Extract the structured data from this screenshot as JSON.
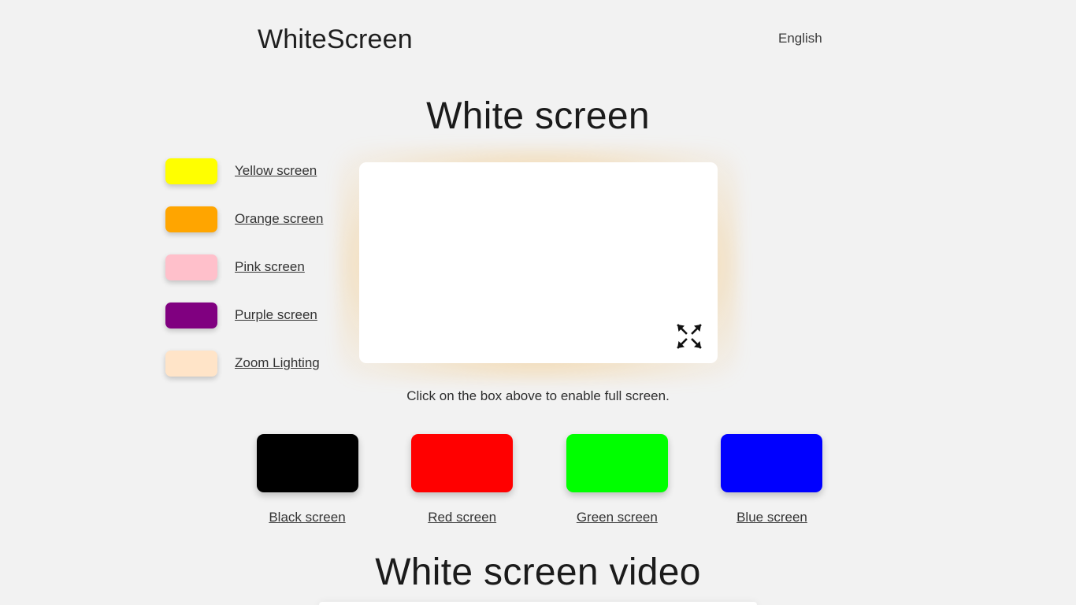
{
  "header": {
    "brand": "WhiteScreen",
    "language": "English"
  },
  "page": {
    "title": "White screen",
    "caption": "Click on the box above to enable full screen.",
    "section_title": "White screen video"
  },
  "sidebar": {
    "items": [
      {
        "label": "Yellow screen",
        "color": "#FFFF00"
      },
      {
        "label": "Orange screen",
        "color": "#FFA500"
      },
      {
        "label": "Pink screen",
        "color": "#FFC0CB"
      },
      {
        "label": "Purple screen",
        "color": "#800080"
      },
      {
        "label": "Zoom Lighting",
        "color": "#FFE4C8"
      }
    ]
  },
  "tiles": [
    {
      "label": "Black screen",
      "color": "#000000"
    },
    {
      "label": "Red screen",
      "color": "#FF0000"
    },
    {
      "label": "Green screen",
      "color": "#00FF00"
    },
    {
      "label": "Blue screen",
      "color": "#0000FF"
    }
  ],
  "screen": {
    "color": "#FFFFFF",
    "glow_color": "#F6B246",
    "fullscreen_icon": "expand-arrows-icon"
  },
  "colors": {
    "background": "#F2F2F2",
    "text": "#2B2B2B",
    "link": "#333333"
  }
}
